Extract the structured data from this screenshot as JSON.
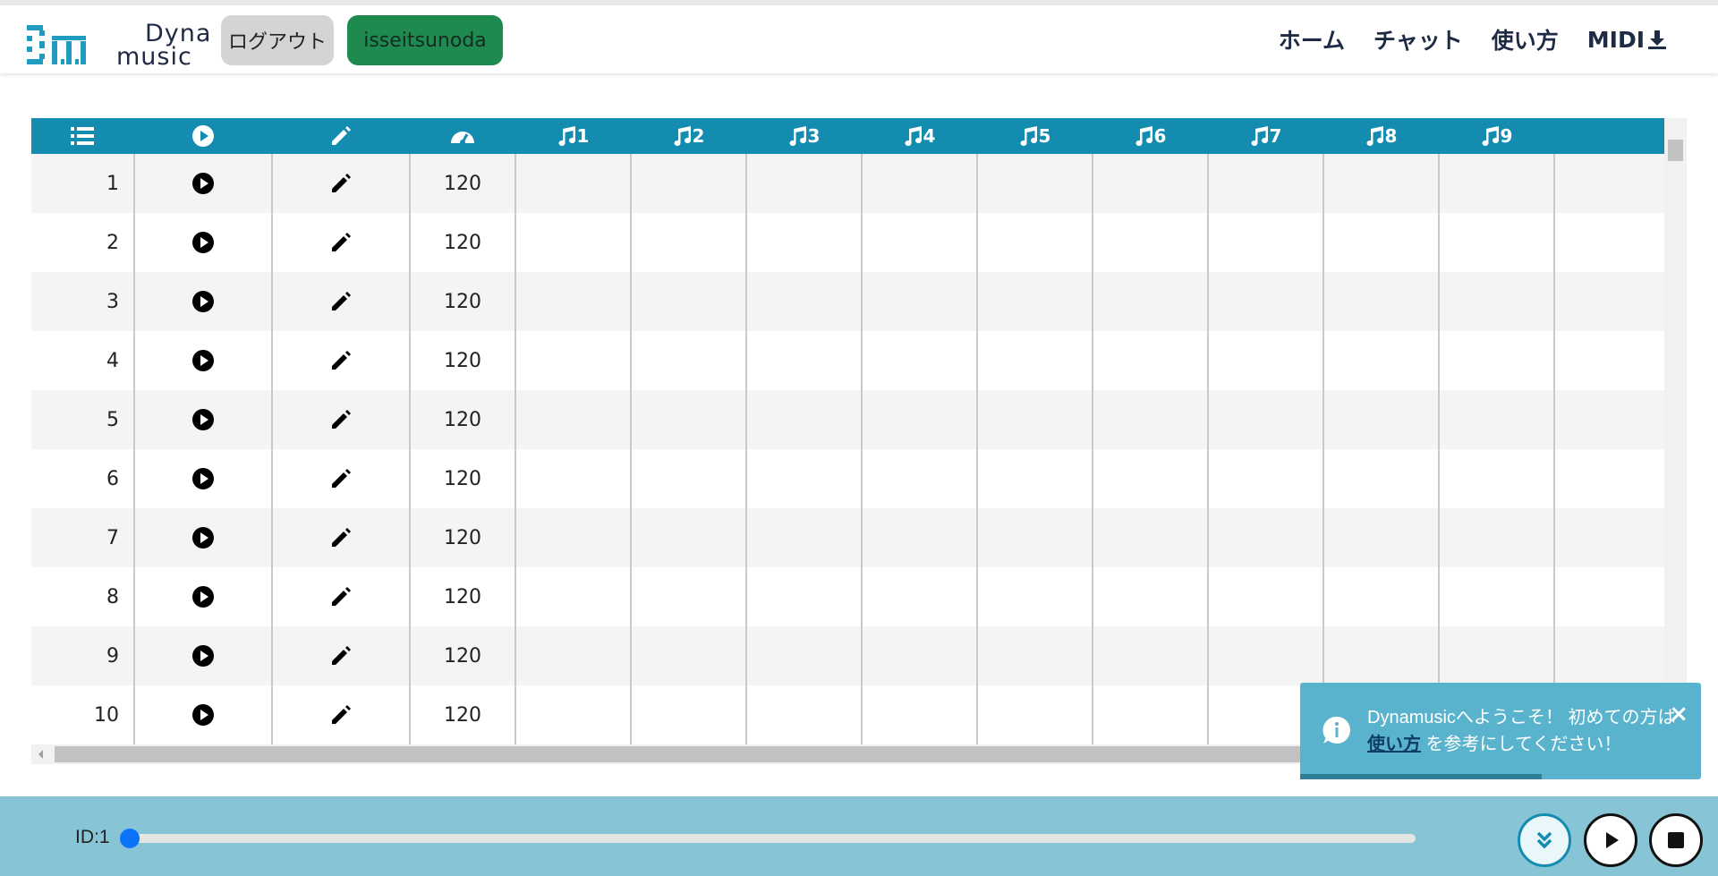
{
  "app": {
    "logo_line1": "Dyna",
    "logo_line2": "music"
  },
  "header": {
    "logout_label": "ログアウト",
    "user_label": "isseitsunoda",
    "nav": {
      "home": "ホーム",
      "chat": "チャット",
      "howto": "使い方",
      "midi": "MIDI"
    }
  },
  "table": {
    "columns": [
      "1",
      "2",
      "3",
      "4",
      "5",
      "6",
      "7",
      "8",
      "9"
    ],
    "rows": [
      {
        "num": "1",
        "tempo": "120"
      },
      {
        "num": "2",
        "tempo": "120"
      },
      {
        "num": "3",
        "tempo": "120"
      },
      {
        "num": "4",
        "tempo": "120"
      },
      {
        "num": "5",
        "tempo": "120"
      },
      {
        "num": "6",
        "tempo": "120"
      },
      {
        "num": "7",
        "tempo": "120"
      },
      {
        "num": "8",
        "tempo": "120"
      },
      {
        "num": "9",
        "tempo": "120"
      },
      {
        "num": "10",
        "tempo": "120"
      }
    ]
  },
  "toast": {
    "message_line1": "Dynamusicへようこそ！ 初めての方は",
    "link_label": "使い方",
    "message_line2_suffix": " を参考にしてください！",
    "close_symbol": "×"
  },
  "player": {
    "id_label": "ID:1",
    "position": 0
  },
  "icons": {
    "header_list": "list-icon",
    "header_play": "play-circle-icon",
    "header_edit": "pencil-icon",
    "header_tempo": "tachometer-icon",
    "track": "music-note-icon",
    "toast": "info-icon",
    "collapse": "chevron-double-down-icon",
    "play": "play-icon",
    "stop": "stop-icon",
    "download": "download-icon"
  },
  "colors": {
    "header_bg": "#148cb0",
    "user_button": "#1f8a4f",
    "logout_button": "#d4d4d4",
    "footer_bg": "#87c4d6",
    "toast_bg": "#5ab3cc",
    "slider_thumb": "#0a73f7"
  }
}
